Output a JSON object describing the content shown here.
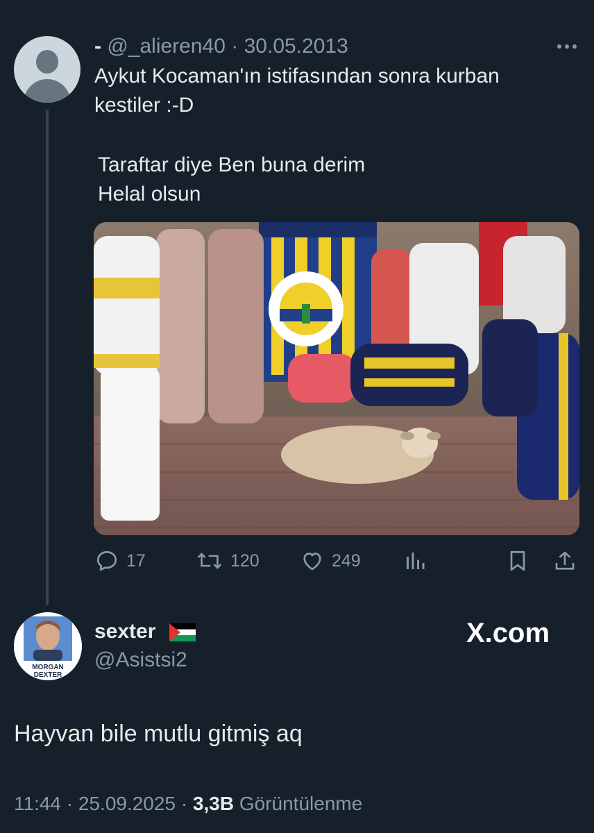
{
  "quoted_tweet": {
    "display_name": "-",
    "handle": "@_alieren40",
    "separator": "·",
    "date": "30.05.2013",
    "text_lines": [
      "Aykut Kocaman'ın istifasından sonra kurban",
      "kestiler :-D",
      "Taraftar diye Ben buna derim",
      "Helal olsun"
    ],
    "image_icon": "photo",
    "actions": {
      "replies": "17",
      "retweets": "120",
      "likes": "249"
    }
  },
  "reply_tweet": {
    "display_name": "sexter",
    "flag_icon": "palestine-flag-icon",
    "handle": "@Asistsi2",
    "avatar_caption_lines": [
      "MORGAN",
      "DEXTER"
    ],
    "text": "Hayvan bile mutlu gitmiş aq",
    "time": "11:44",
    "separator": "·",
    "date": "25.09.2025",
    "views_count": "3,3B",
    "views_label": "Görüntülenme"
  },
  "watermark": "X.com",
  "colors": {
    "background": "#15202b",
    "primary_text": "#e7e9ea",
    "secondary_text": "#8b98a5",
    "thread_line": "#38444d"
  }
}
